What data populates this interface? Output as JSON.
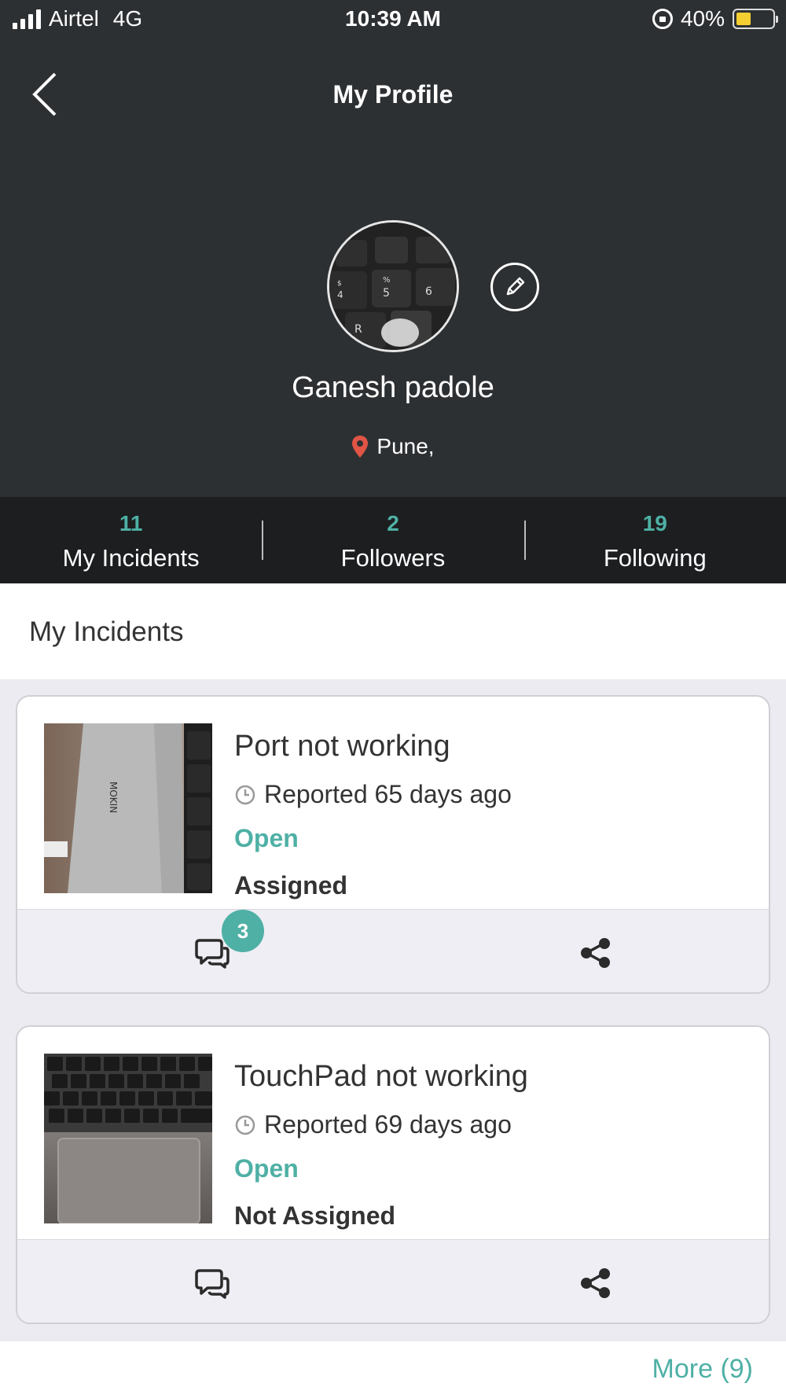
{
  "status_bar": {
    "carrier": "Airtel",
    "network": "4G",
    "time": "10:39 AM",
    "battery": "40%",
    "battery_level": 0.4
  },
  "header": {
    "title": "My Profile"
  },
  "profile": {
    "name": "Ganesh padole",
    "location": "Pune,"
  },
  "stats": [
    {
      "count": "11",
      "label": "My Incidents"
    },
    {
      "count": "2",
      "label": "Followers"
    },
    {
      "count": "19",
      "label": "Following"
    }
  ],
  "section": {
    "title": "My Incidents"
  },
  "incidents": [
    {
      "title": "Port not working",
      "reported": "Reported 65 days ago",
      "status": "Open",
      "assignment": "Assigned",
      "comment_count": "3"
    },
    {
      "title": "TouchPad not working",
      "reported": "Reported 69 days ago",
      "status": "Open",
      "assignment": "Not Assigned",
      "comment_count": ""
    }
  ],
  "footer": {
    "more_label": "More (9)"
  },
  "colors": {
    "accent": "#4fb0a5",
    "header_bg": "#2d3033",
    "stats_bg": "#1c1e1f",
    "location_pin": "#e05545"
  },
  "icons": {
    "back": "chevron-left-icon",
    "edit": "pencil-icon",
    "location": "map-pin-icon",
    "clock": "clock-icon",
    "comment": "comment-icon",
    "share": "share-icon"
  }
}
